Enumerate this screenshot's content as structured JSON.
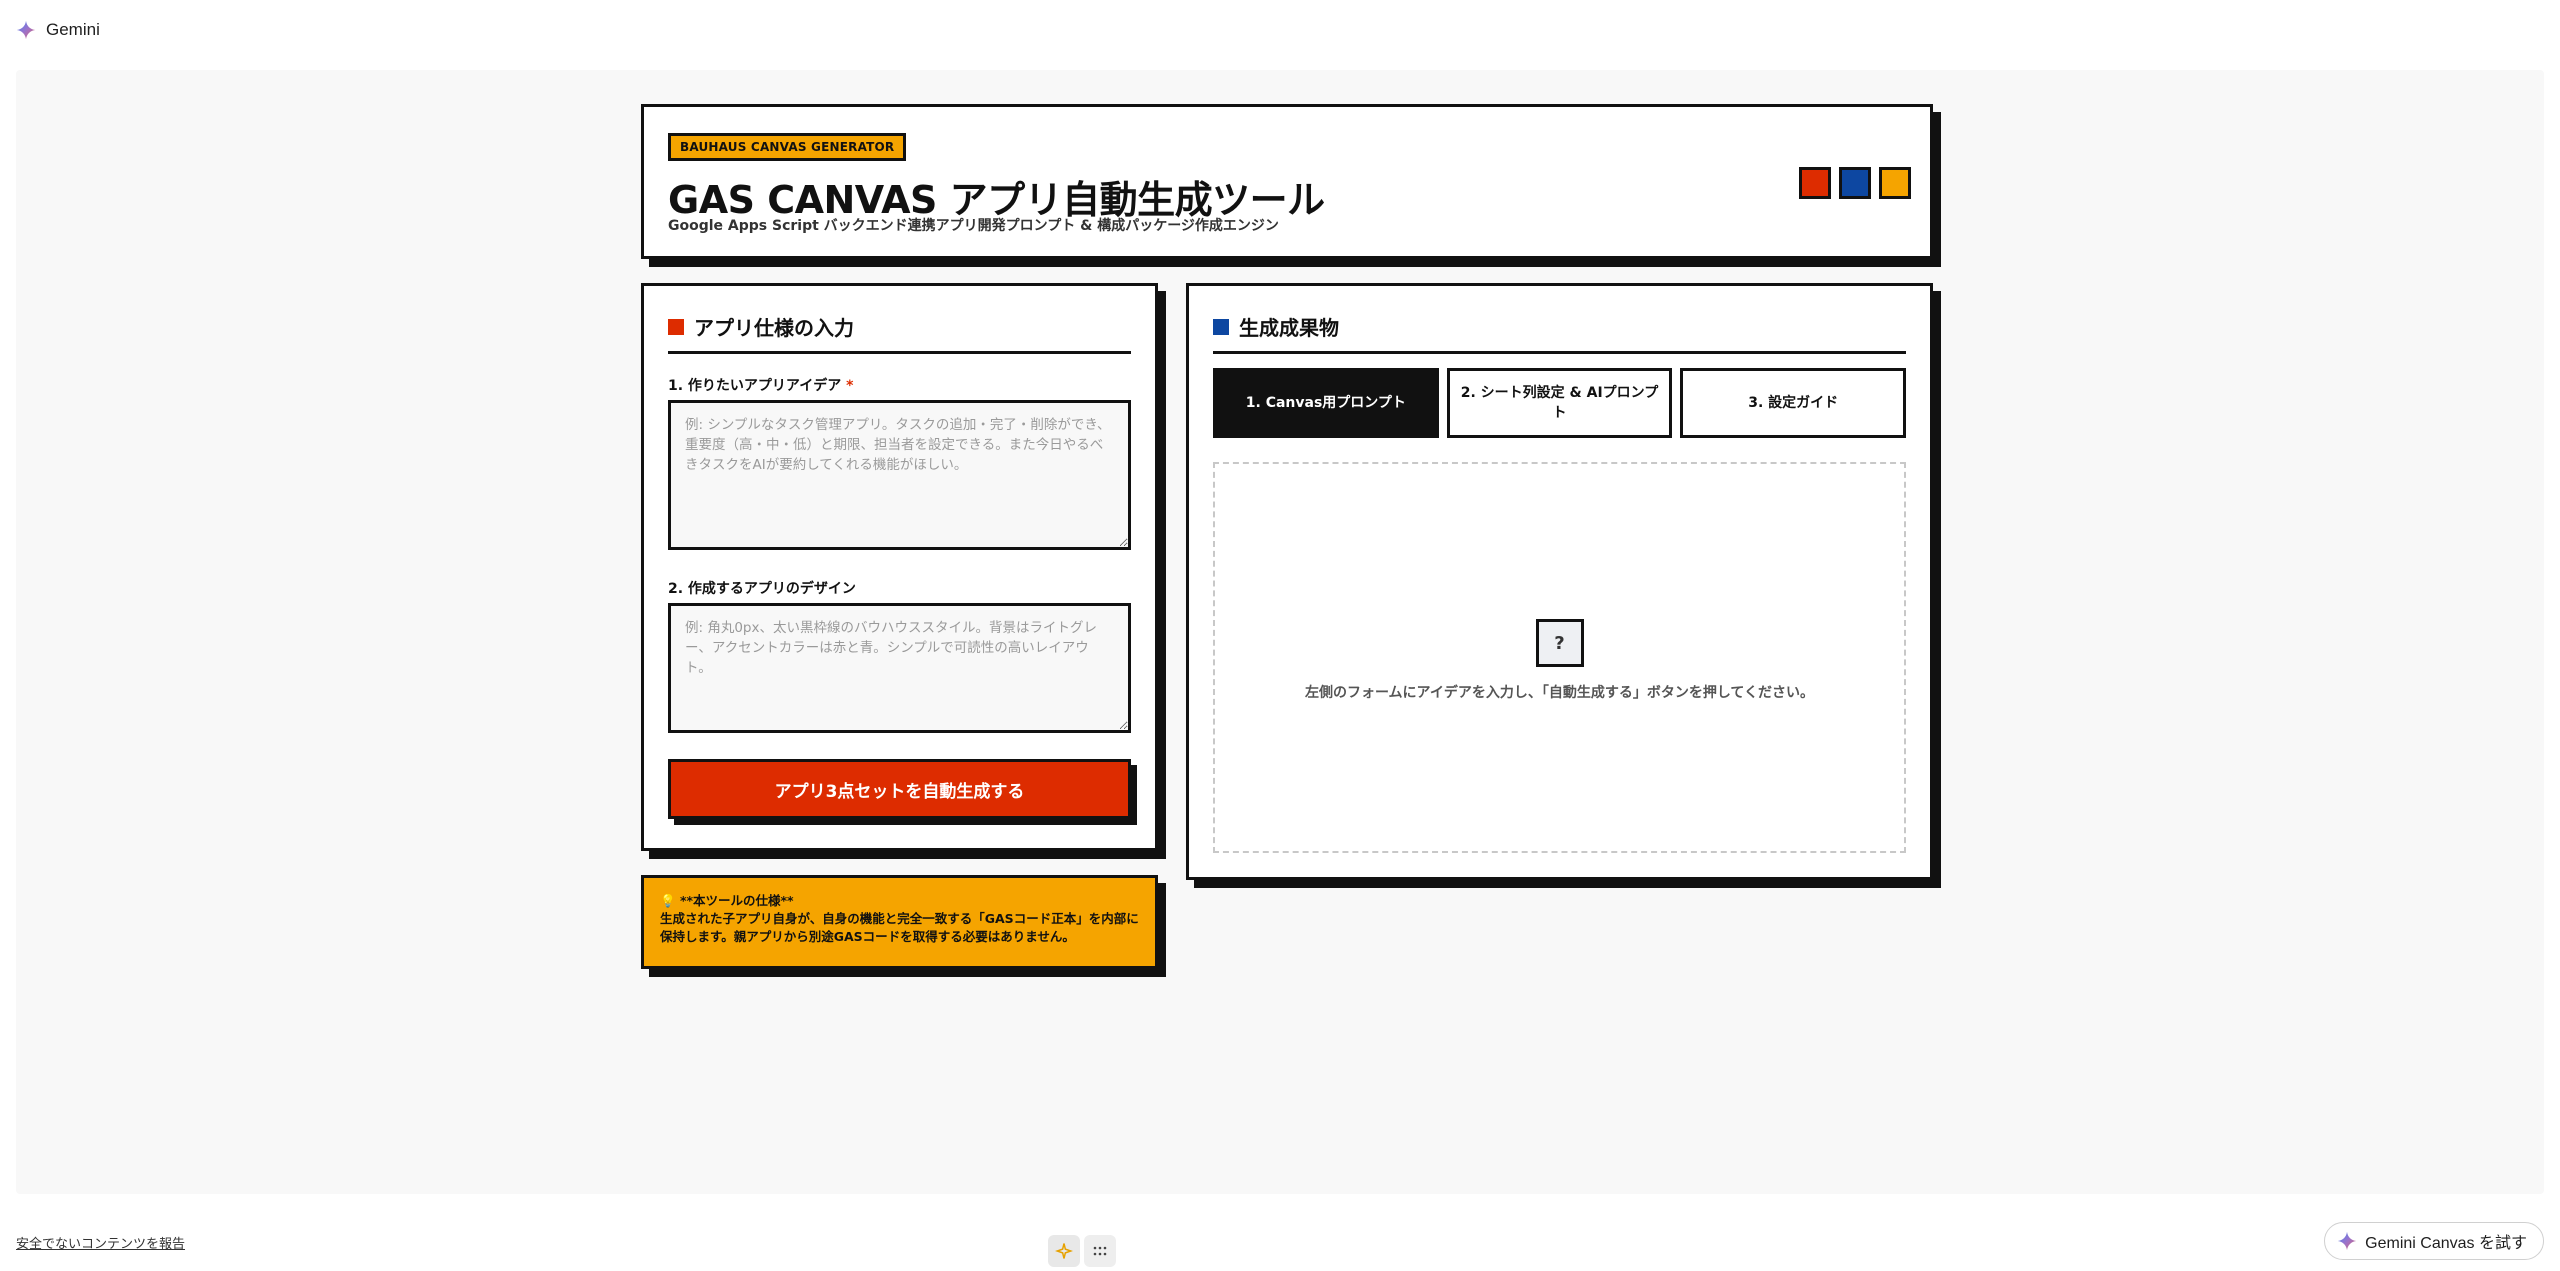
{
  "app": {
    "name": "Gemini"
  },
  "header": {
    "badge": "BAUHAUS CANVAS GENERATOR",
    "title": "GAS CANVAS アプリ自動生成ツール",
    "subtitle": "Google Apps Script バックエンド連携アプリ開発プロンプト & 構成パッケージ作成エンジン",
    "swatches": [
      "#dd2c00",
      "#0d47a1",
      "#f5a400"
    ]
  },
  "form": {
    "heading": "アプリ仕様の入力",
    "idea_label": "1. 作りたいアプリアイデア",
    "idea_required": "*",
    "idea_placeholder": "例: シンプルなタスク管理アプリ。タスクの追加・完了・削除ができ、重要度（高・中・低）と期限、担当者を設定できる。また今日やるべきタスクをAIが要約してくれる機能がほしい。",
    "design_label": "2. 作成するアプリのデザイン",
    "design_placeholder": "例: 角丸0px、太い黒枠線のバウハウススタイル。背景はライトグレー、アクセントカラーは赤と青。シンプルで可読性の高いレイアウト。",
    "generate_button": "アプリ3点セットを自動生成する"
  },
  "note": {
    "title": "**本ツールの仕様**",
    "body": "生成された子アプリ自身が、自身の機能と完全一致する「GASコード正本」を内部に保持します。親アプリから別途GASコードを取得する必要はありません。"
  },
  "output": {
    "heading": "生成成果物",
    "tabs": [
      {
        "label": "1. Canvas用プロンプト",
        "active": true
      },
      {
        "label": "2. シート列設定 & AIプロンプト",
        "active": false
      },
      {
        "label": "3. 設定ガイド",
        "active": false
      }
    ],
    "empty_icon": "?",
    "empty_hint": "左側のフォームにアイデアを入力し、「自動生成する」ボタンを押してください。"
  },
  "footer": {
    "report_link": "安全でないコンテンツを報告",
    "try_button": "Gemini Canvas を試す"
  },
  "colors": {
    "red": "#dd2c00",
    "blue": "#0d47a1",
    "yellow": "#f5a400",
    "black": "#111111"
  }
}
